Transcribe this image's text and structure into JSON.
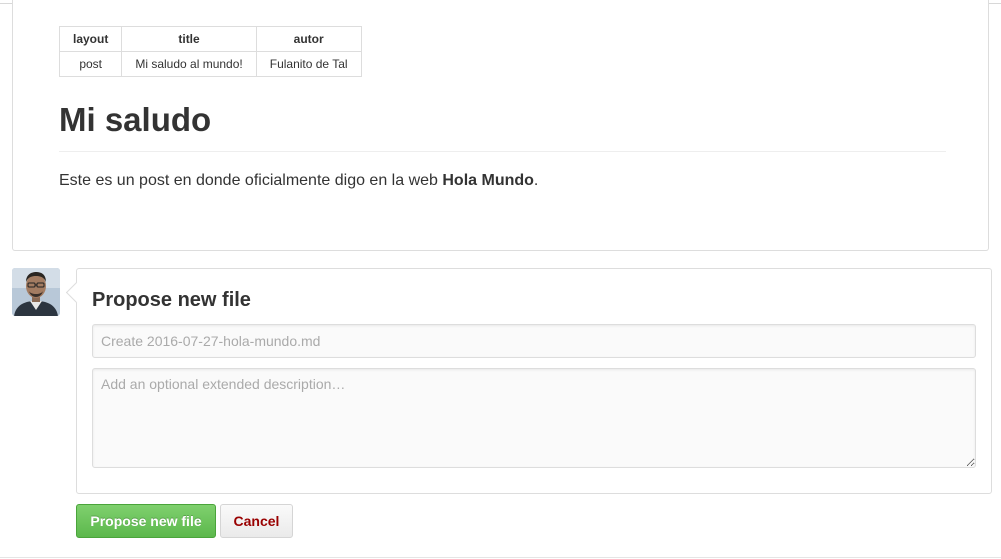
{
  "preview": {
    "front_matter": {
      "headers": [
        "layout",
        "title",
        "autor"
      ],
      "rows": [
        [
          "post",
          "Mi saludo al mundo!",
          "Fulanito de Tal"
        ]
      ]
    },
    "title": "Mi saludo",
    "body_prefix": "Este es un post en donde oficialmente digo en la web ",
    "body_bold": "Hola Mundo",
    "body_suffix": "."
  },
  "commit": {
    "heading": "Propose new file",
    "summary_placeholder": "Create 2016-07-27-hola-mundo.md",
    "summary_value": "",
    "description_placeholder": "Add an optional extended description…",
    "description_value": ""
  },
  "buttons": {
    "propose_label": "Propose new file",
    "cancel_label": "Cancel"
  },
  "colors": {
    "propose_button": "#5cb84c",
    "cancel_text": "#990000",
    "border": "#dddddd"
  }
}
